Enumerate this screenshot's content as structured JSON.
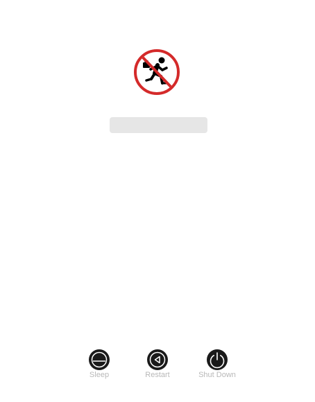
{
  "login": {
    "avatar": "running-man-prohibition-icon",
    "password_placeholder": ""
  },
  "power_buttons": [
    {
      "label": "Sleep",
      "icon": "sleep-icon"
    },
    {
      "label": "Restart",
      "icon": "restart-icon"
    },
    {
      "label": "Shut Down",
      "icon": "shutdown-icon"
    }
  ],
  "colors": {
    "background": "#ffffff",
    "avatar_ring": "#d42a2a",
    "field_background": "#e6e6e6",
    "button_icon": "#1a1a1a",
    "button_label": "#b8b8b8"
  }
}
